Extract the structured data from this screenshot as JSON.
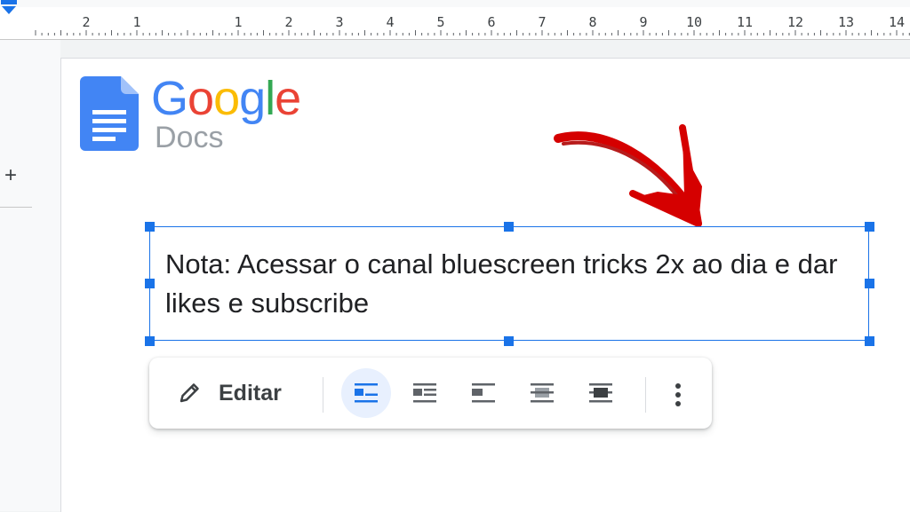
{
  "ruler": {
    "labels": [
      "2",
      "1",
      "1",
      "2",
      "3",
      "4",
      "5",
      "6",
      "7",
      "8",
      "9",
      "10",
      "11",
      "12",
      "13",
      "14"
    ]
  },
  "sidebar": {
    "add_glyph": "+"
  },
  "logo": {
    "brand_letters": [
      "G",
      "o",
      "o",
      "g",
      "l",
      "e"
    ],
    "brand_colors": [
      "#4285f4",
      "#ea4335",
      "#fbbc05",
      "#4285f4",
      "#34a853",
      "#ea4335"
    ],
    "product": "Docs"
  },
  "note": {
    "text": "Nota: Acessar o canal bluescreen tricks 2x ao dia e dar likes e subscribe"
  },
  "toolbar": {
    "edit_label": "Editar",
    "wrap_options": [
      {
        "icon": "in-line-icon",
        "active": true
      },
      {
        "icon": "wrap-text-icon",
        "active": false
      },
      {
        "icon": "break-text-icon",
        "active": false
      },
      {
        "icon": "behind-text-icon",
        "active": false
      },
      {
        "icon": "in-front-of-text-icon",
        "active": false
      }
    ],
    "more_icon": "more-vert-icon"
  },
  "colors": {
    "selection": "#1a73e8",
    "arrow": "#d50000",
    "active_bg": "#e8f0fe"
  }
}
